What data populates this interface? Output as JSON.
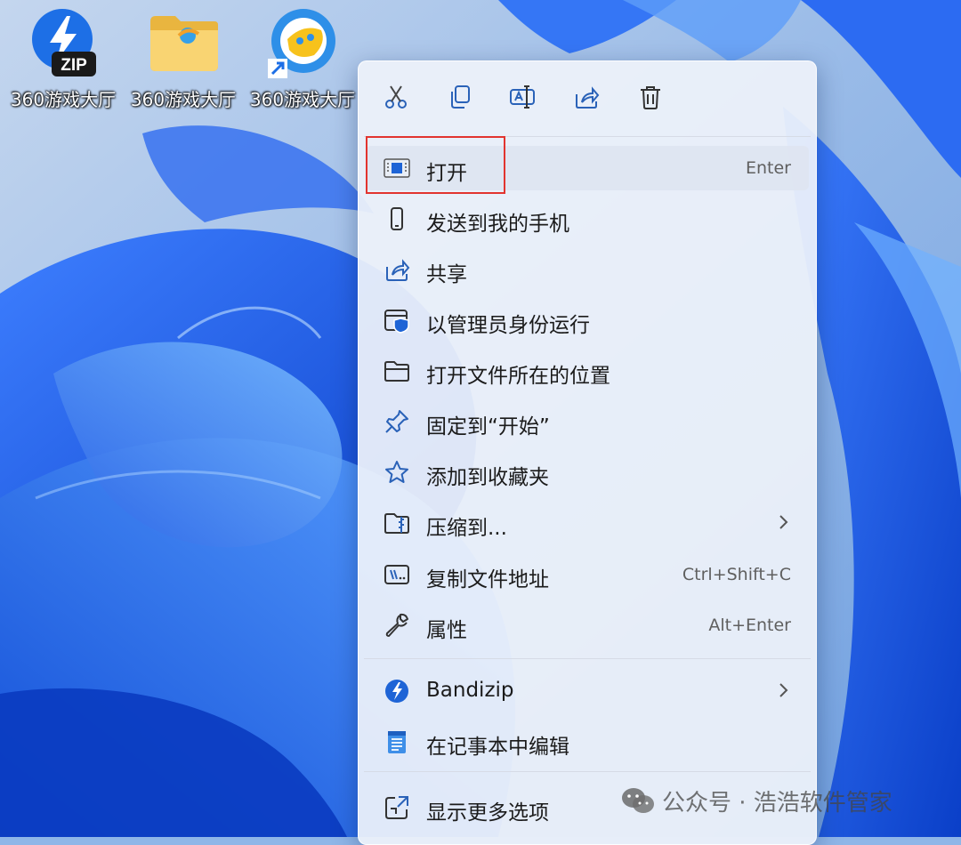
{
  "desktop": {
    "icons": [
      {
        "label": "360游戏大厅",
        "icon": "bandizip-zip-icon"
      },
      {
        "label": "360游戏大厅",
        "icon": "folder-icon"
      },
      {
        "label": "360游戏大厅",
        "icon": "360-game-shortcut-icon"
      }
    ]
  },
  "context_menu": {
    "toolbar": [
      "cut-icon",
      "copy-icon",
      "rename-icon",
      "share-icon",
      "delete-icon"
    ],
    "items": [
      {
        "label": "打开",
        "shortcut": "Enter",
        "icon": "open-app-icon",
        "highlighted": true
      },
      {
        "label": "发送到我的手机",
        "shortcut": "",
        "icon": "phone-icon"
      },
      {
        "label": "共享",
        "shortcut": "",
        "icon": "share-icon"
      },
      {
        "label": "以管理员身份运行",
        "shortcut": "",
        "icon": "admin-shield-icon"
      },
      {
        "label": "打开文件所在的位置",
        "shortcut": "",
        "icon": "folder-open-icon"
      },
      {
        "label": "固定到“开始”",
        "shortcut": "",
        "icon": "pin-icon"
      },
      {
        "label": "添加到收藏夹",
        "shortcut": "",
        "icon": "star-icon"
      },
      {
        "label": "压缩到...",
        "shortcut": "",
        "icon": "zip-folder-icon",
        "submenu": true
      },
      {
        "label": "复制文件地址",
        "shortcut": "Ctrl+Shift+C",
        "icon": "copy-path-icon"
      },
      {
        "label": "属性",
        "shortcut": "Alt+Enter",
        "icon": "wrench-icon"
      },
      {
        "label": "Bandizip",
        "shortcut": "",
        "icon": "bandizip-icon",
        "submenu": true
      },
      {
        "label": "在记事本中编辑",
        "shortcut": "",
        "icon": "notepad-icon"
      },
      {
        "label": "显示更多选项",
        "shortcut": "",
        "icon": "more-options-icon"
      }
    ]
  },
  "watermark": {
    "text": "公众号 · 浩浩软件管家",
    "icon": "wechat-icon"
  },
  "colors": {
    "highlight_border": "#e2342f",
    "accent": "#0067c0"
  }
}
